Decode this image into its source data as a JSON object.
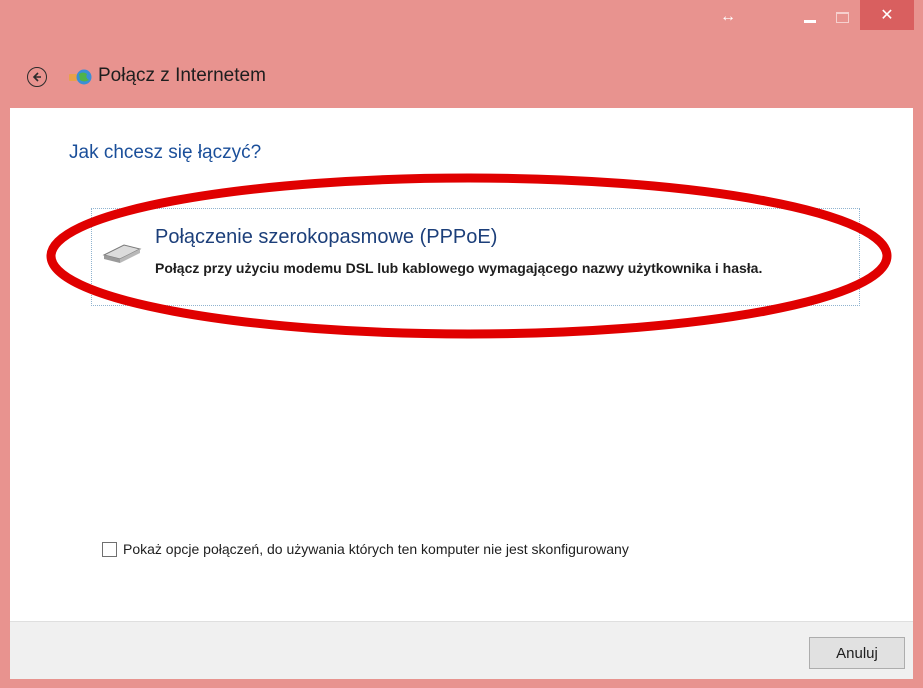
{
  "window": {
    "title": "Połącz z Internetem",
    "accent_color": "#e8938f",
    "close_color": "#d95f5f"
  },
  "titlebar": {
    "resize_icon": "↔",
    "close_icon": "✕"
  },
  "content": {
    "question": "Jak chcesz się łączyć?",
    "option": {
      "title": "Połączenie szerokopasmowe (PPPoE)",
      "description": "Połącz przy użyciu modemu DSL lub kablowego wymagającego nazwy użytkownika i hasła.",
      "icon": "modem-icon"
    },
    "checkbox": {
      "label": "Pokaż opcje połączeń, do używania których ten komputer nie jest skonfigurowany",
      "checked": false
    },
    "highlight_color": "#e00000"
  },
  "footer": {
    "cancel_label": "Anuluj"
  }
}
